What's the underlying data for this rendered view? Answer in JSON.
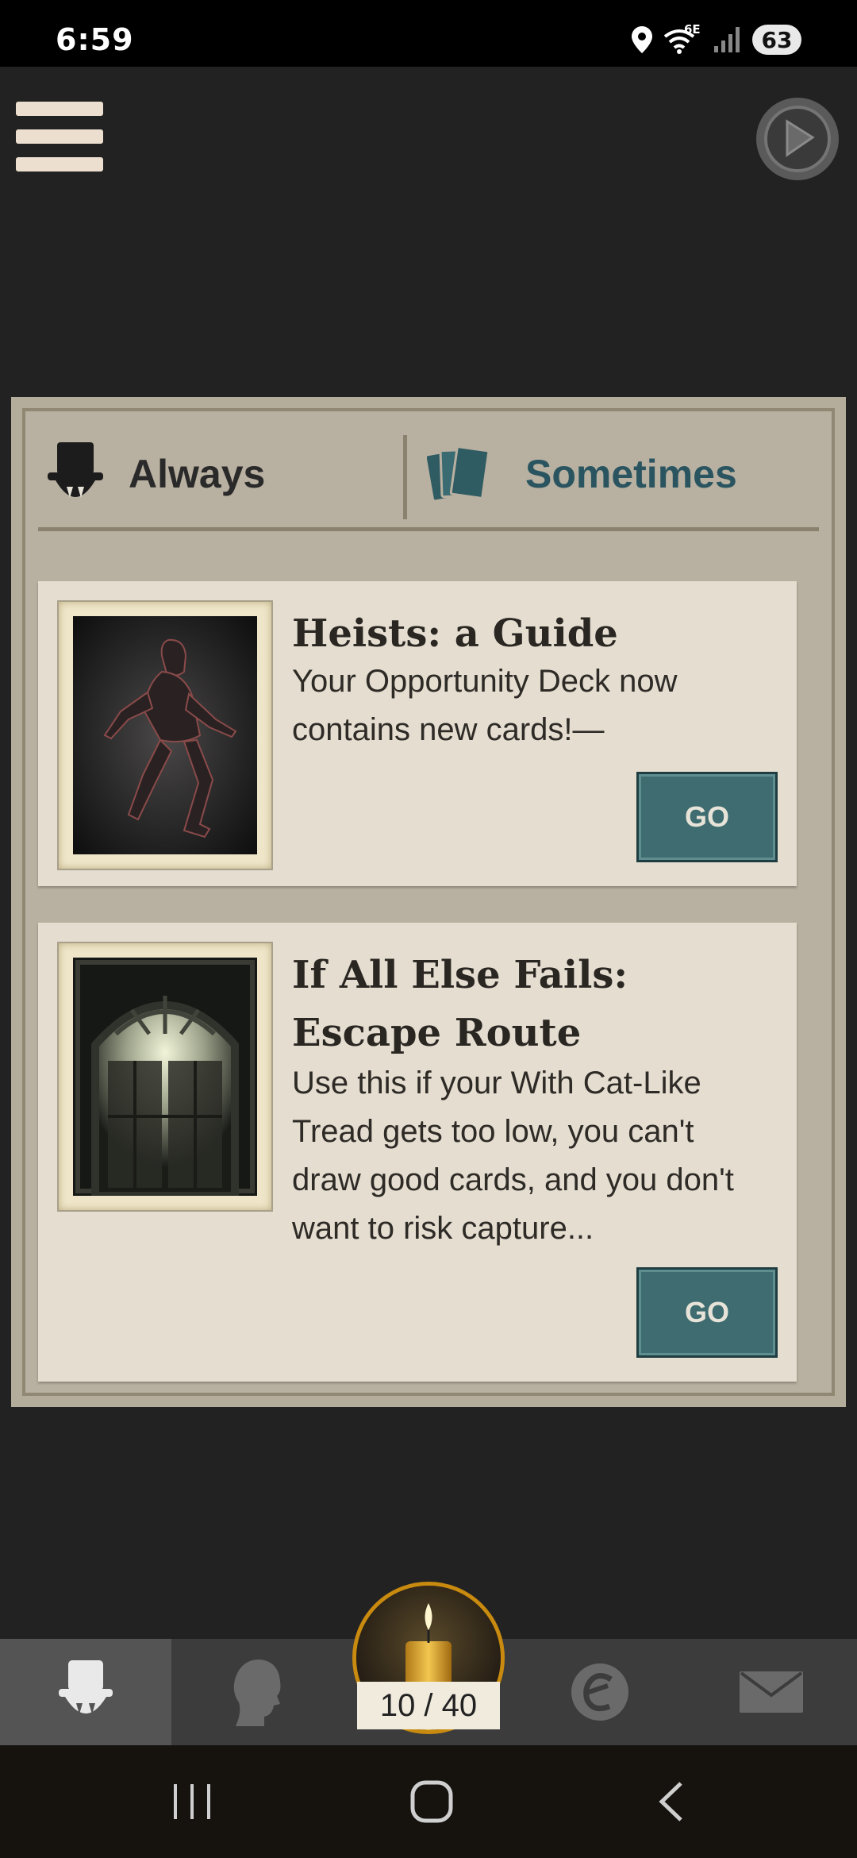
{
  "status_bar": {
    "time": "6:59",
    "network_label": "6E",
    "battery": "63"
  },
  "header": {
    "menu_icon": "hamburger-menu-icon",
    "play_icon": "play-circle-icon"
  },
  "tabs": [
    {
      "label": "Always",
      "icon": "top-hat-fangs-icon",
      "active": true
    },
    {
      "label": "Sometimes",
      "icon": "cards-deck-icon",
      "active": false
    }
  ],
  "storylets": [
    {
      "title": "Heists: a Guide",
      "description": "Your Opportunity Deck now contains new cards!—",
      "image": "hooded-thief-image",
      "button_label": "GO"
    },
    {
      "title": "If All Else Fails: Escape Route",
      "description": "Use this if your With Cat-Like Tread gets too low, you can't draw good cards, and you don't want to risk capture...",
      "image": "arched-door-image",
      "button_label": "GO"
    }
  ],
  "bottom_nav": {
    "items": [
      {
        "icon": "top-hat-fangs-icon",
        "active": true
      },
      {
        "icon": "profile-silhouette-icon",
        "active": false
      },
      {
        "icon": "echo-currency-icon",
        "active": false
      },
      {
        "icon": "mail-envelope-icon",
        "active": false
      }
    ],
    "actions": {
      "current": "10",
      "max": "40",
      "display": "10 / 40",
      "icon": "candle-icon"
    }
  },
  "system_nav": {
    "recent_icon": "recent-apps-icon",
    "home_icon": "home-circle-icon",
    "back_icon": "back-chevron-icon"
  },
  "colors": {
    "background": "#222222",
    "panel": "#b8b0a0",
    "card": "#e4ddd0",
    "accent_teal": "#3e6c70",
    "sometimes_text": "#2a5560",
    "candle_ring": "#c88a0f"
  }
}
